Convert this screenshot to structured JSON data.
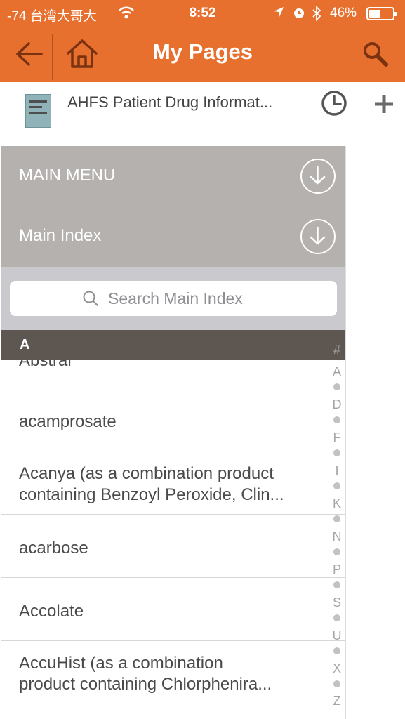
{
  "status_bar": {
    "carrier": "-74 台湾大哥大",
    "time": "8:52",
    "battery_percent": "46%",
    "battery_level": 0.46
  },
  "nav": {
    "title": "My Pages",
    "back_icon": "arrow-left-icon",
    "home_icon": "home-icon",
    "search_icon": "magnifier-icon"
  },
  "book": {
    "title": "AHFS Patient Drug Informat...",
    "history_icon": "clock-icon",
    "add_icon": "plus-icon"
  },
  "panel": {
    "main_menu_label": "MAIN MENU",
    "main_index_label": "Main Index",
    "search_placeholder": "Search Main Index",
    "section_letter": "A",
    "items": [
      "Abstral",
      "acamprosate",
      "Acanya (as a combination product",
      "containing Benzoyl Peroxide, Clin...",
      "acarbose",
      "Accolate",
      "AccuHist (as a combination",
      "product containing Chlorphenira..."
    ]
  },
  "index_bar": {
    "letters": [
      "#",
      "A",
      "D",
      "F",
      "I",
      "K",
      "N",
      "P",
      "S",
      "U",
      "X",
      "Z"
    ]
  },
  "colors": {
    "brand_orange": "#e8702f",
    "menu_gray": "#b4b1ae",
    "section_brown": "#5e5651"
  }
}
